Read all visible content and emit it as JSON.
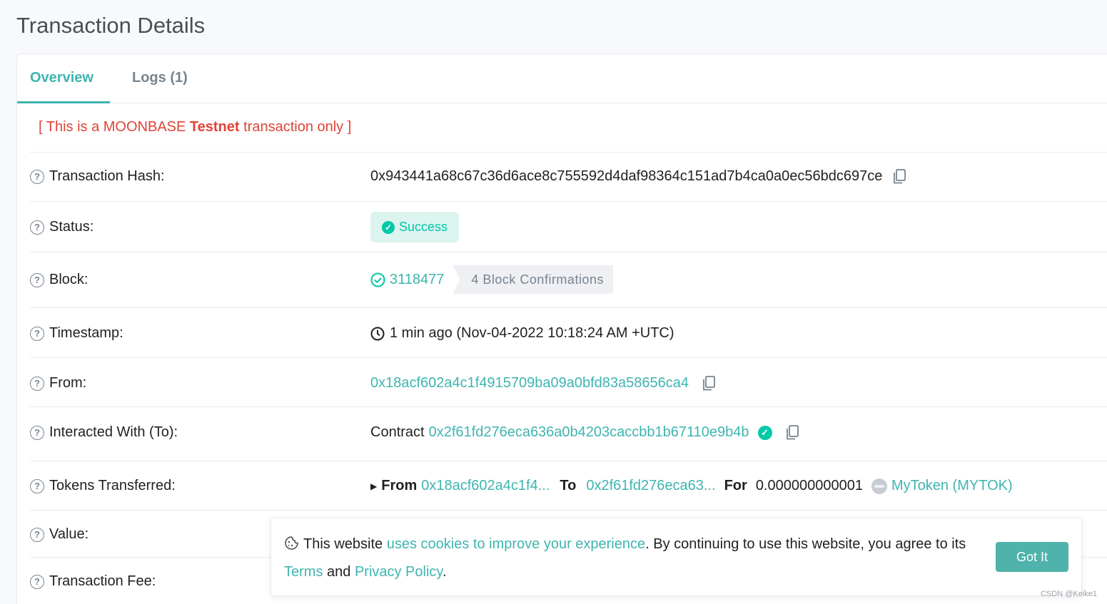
{
  "page": {
    "title": "Transaction Details"
  },
  "tabs": [
    {
      "label": "Overview",
      "active": true
    },
    {
      "label": "Logs (1)",
      "active": false
    }
  ],
  "notice": {
    "prefix": "[ This is a MOONBASE ",
    "bold": "Testnet",
    "suffix": " transaction only ]",
    "color": "#de4437"
  },
  "rows": {
    "hash": {
      "label": "Transaction Hash:",
      "value": "0x943441a68c67c36d6ace8c755592d4daf98364c151ad7b4ca0a0ec56bdc697ce"
    },
    "status": {
      "label": "Status:",
      "value": "Success"
    },
    "block": {
      "label": "Block:",
      "value": "3118477",
      "confirmations": "4 Block Confirmations"
    },
    "timestamp": {
      "label": "Timestamp:",
      "value": "1 min ago (Nov-04-2022 10:18:24 AM +UTC)"
    },
    "from": {
      "label": "From:",
      "value": "0x18acf602a4c1f4915709ba09a0bfd83a58656ca4"
    },
    "to": {
      "label": "Interacted With (To):",
      "prefix": "Contract",
      "value": "0x2f61fd276eca636a0b4203caccbb1b67110e9b4b"
    },
    "tokens": {
      "label": "Tokens Transferred:",
      "from_label": "From",
      "from_value": "0x18acf602a4c1f4...",
      "to_label": "To",
      "to_value": "0x2f61fd276eca63...",
      "for_label": "For",
      "amount": "0.000000000001",
      "token": "MyToken (MYTOK)"
    },
    "value": {
      "label": "Value:"
    },
    "fee": {
      "label": "Transaction Fee:"
    }
  },
  "cookie": {
    "text1": "This website ",
    "link1": "uses cookies to improve your experience",
    "text2": ". By continuing to use this website, you agree to its ",
    "link2": "Terms",
    "text3": " and ",
    "link3": "Privacy Policy",
    "text4": ".",
    "button": "Got It"
  },
  "watermark": "CSDN @Keike1",
  "colors": {
    "accent": "#3eb5b0",
    "success": "#00c9a7",
    "danger": "#de4437"
  }
}
